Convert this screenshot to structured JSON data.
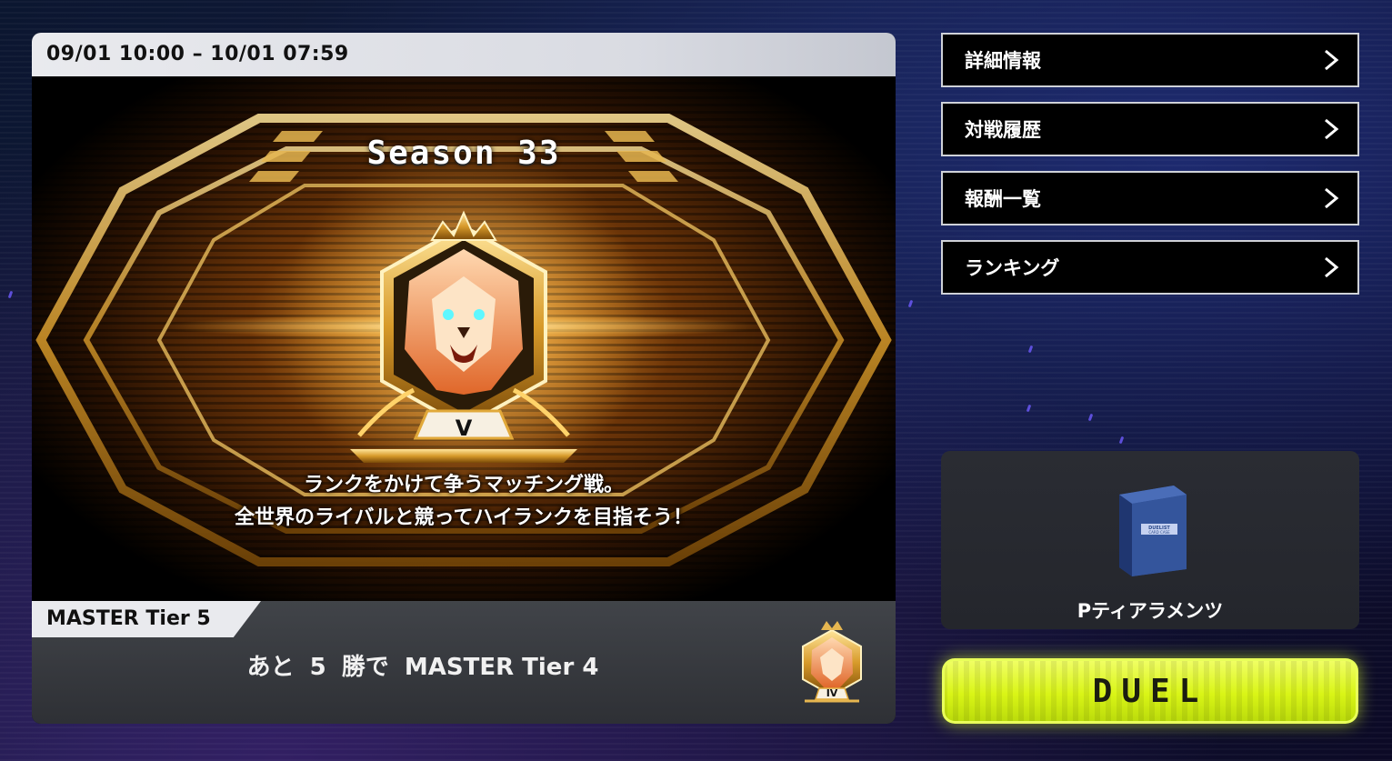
{
  "season": {
    "period": "09/01 10:00 – 10/01 07:59",
    "title": "Season 33",
    "rank_numeral": "V",
    "description_line1": "ランクをかけて争うマッチング戦。",
    "description_line2": "全世界のライバルと競ってハイランクを目指そう！"
  },
  "tier": {
    "current": "MASTER Tier 5",
    "progress_prefix": "あと",
    "wins_needed": "5",
    "progress_suffix": "勝で",
    "next": "MASTER Tier 4",
    "next_numeral": "IV"
  },
  "menu": [
    {
      "label": "詳細情報"
    },
    {
      "label": "対戦履歴"
    },
    {
      "label": "報酬一覧"
    },
    {
      "label": "ランキング"
    }
  ],
  "deck": {
    "name": "Pティアラメンツ",
    "box_label_1": "DUELIST",
    "box_label_2": "CARD CASE"
  },
  "duel_button": {
    "label": "DUEL"
  },
  "colors": {
    "accent_lime": "#d9f516",
    "gold": "#e0a83a",
    "menu_border": "#cfd2d8"
  }
}
